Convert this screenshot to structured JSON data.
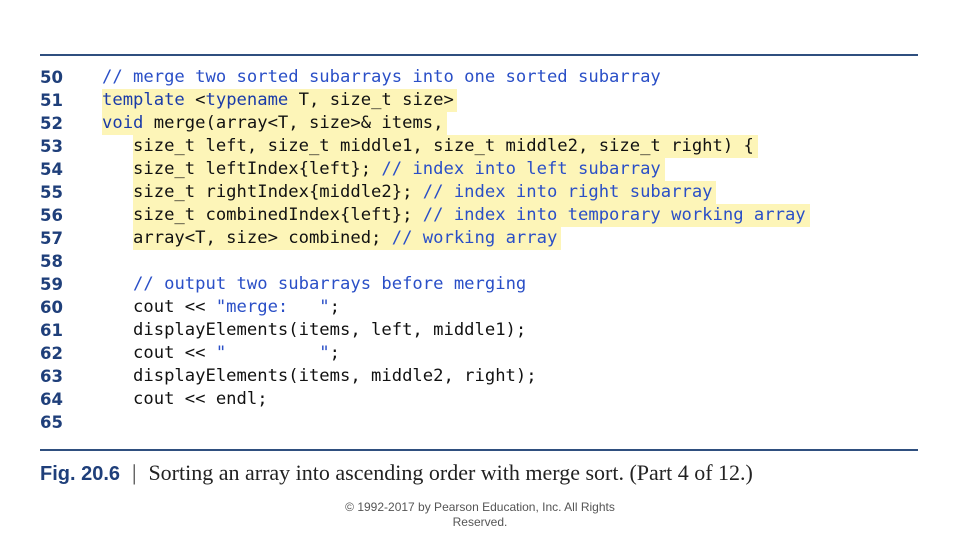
{
  "colors": {
    "rule": "#2f4f7f",
    "highlight": "#fdf5b8",
    "keyword": "#1a3ba8",
    "comment": "#2a4fc7"
  },
  "lines": [
    {
      "n": "50",
      "parts": [
        {
          "t": "// merge two sorted subarrays into one sorted subarray",
          "c": "cm"
        }
      ],
      "hl": false
    },
    {
      "n": "51",
      "parts": [
        {
          "t": "template",
          "c": "kw"
        },
        {
          "t": " <",
          "c": ""
        },
        {
          "t": "typename",
          "c": "kw"
        },
        {
          "t": " T, size_t size>",
          "c": ""
        }
      ],
      "hl": true
    },
    {
      "n": "52",
      "parts": [
        {
          "t": "void",
          "c": "kw"
        },
        {
          "t": " merge(array<T, size>& items,",
          "c": ""
        }
      ],
      "hl": true
    },
    {
      "n": "53",
      "parts": [
        {
          "t": "   size_t left, size_t middle1, size_t middle2, size_t right) {",
          "c": ""
        }
      ],
      "hl": true
    },
    {
      "n": "54",
      "parts": [
        {
          "t": "   size_t leftIndex{left}; ",
          "c": ""
        },
        {
          "t": "// index into left subarray",
          "c": "cm"
        }
      ],
      "hl": true
    },
    {
      "n": "55",
      "parts": [
        {
          "t": "   size_t rightIndex{middle2}; ",
          "c": ""
        },
        {
          "t": "// index into right subarray",
          "c": "cm"
        }
      ],
      "hl": true
    },
    {
      "n": "56",
      "parts": [
        {
          "t": "   size_t combinedIndex{left}; ",
          "c": ""
        },
        {
          "t": "// index into temporary working array",
          "c": "cm"
        }
      ],
      "hl": true
    },
    {
      "n": "57",
      "parts": [
        {
          "t": "   array<T, size> combined; ",
          "c": ""
        },
        {
          "t": "// working array",
          "c": "cm"
        }
      ],
      "hl": true
    },
    {
      "n": "58",
      "parts": [],
      "hl": false
    },
    {
      "n": "59",
      "parts": [
        {
          "t": "   ",
          "c": ""
        },
        {
          "t": "// output two subarrays before merging",
          "c": "cm"
        }
      ],
      "hl": false
    },
    {
      "n": "60",
      "parts": [
        {
          "t": "   cout << ",
          "c": ""
        },
        {
          "t": "\"merge:   \"",
          "c": "st"
        },
        {
          "t": ";",
          "c": ""
        }
      ],
      "hl": false
    },
    {
      "n": "61",
      "parts": [
        {
          "t": "   displayElements(items, left, middle1);",
          "c": ""
        }
      ],
      "hl": false
    },
    {
      "n": "62",
      "parts": [
        {
          "t": "   cout << ",
          "c": ""
        },
        {
          "t": "\"         \"",
          "c": "st"
        },
        {
          "t": ";",
          "c": ""
        }
      ],
      "hl": false
    },
    {
      "n": "63",
      "parts": [
        {
          "t": "   displayElements(items, middle2, right);",
          "c": ""
        }
      ],
      "hl": false
    },
    {
      "n": "64",
      "parts": [
        {
          "t": "   cout << endl;",
          "c": ""
        }
      ],
      "hl": false
    },
    {
      "n": "65",
      "parts": [],
      "hl": false
    }
  ],
  "caption": {
    "label": "Fig. 20.6",
    "separator": "|",
    "text": "Sorting an array into ascending order with merge sort. (Part 4 of 12.)"
  },
  "footer": {
    "line1": "© 1992-2017 by Pearson Education, Inc. All Rights",
    "line2": "Reserved."
  }
}
